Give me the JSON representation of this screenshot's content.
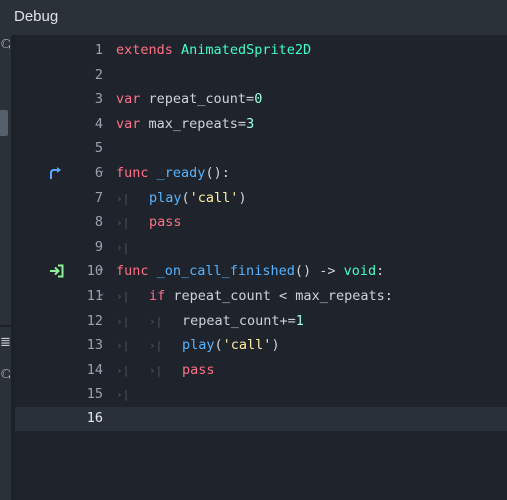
{
  "window": {
    "title": "Debug"
  },
  "colors": {
    "keyword": "#ff7085",
    "class_name": "#42ffc2",
    "function": "#57b3ff",
    "string": "#ffeda1",
    "number": "#a1ffe0",
    "text": "#cdd3db",
    "background": "#1f242c"
  },
  "lines": [
    {
      "n": "1",
      "t1": "extends",
      "t2": " ",
      "t3": "AnimatedSprite2D"
    },
    {
      "n": "2"
    },
    {
      "n": "3",
      "t1": "var",
      "t2": " repeat_count=",
      "t3": "0"
    },
    {
      "n": "4",
      "t1": "var",
      "t2": " max_repeats=",
      "t3": "3"
    },
    {
      "n": "5"
    },
    {
      "n": "6",
      "t1": "func",
      "t2": " ",
      "t3": "_ready",
      "t4": "():"
    },
    {
      "n": "7",
      "t1": "play",
      "t2": "(",
      "t3": "'call'",
      "t4": ")"
    },
    {
      "n": "8",
      "t1": "pass"
    },
    {
      "n": "9"
    },
    {
      "n": "10",
      "t1": "func",
      "t2": " ",
      "t3": "_on_call_finished",
      "t4": "() -> ",
      "t5": "void",
      "t6": ":"
    },
    {
      "n": "11",
      "t1": "if",
      "t2": " repeat_count < max_repeats:"
    },
    {
      "n": "12",
      "t1": "repeat_count+=",
      "t2": "1"
    },
    {
      "n": "13",
      "t1": "play",
      "t2": "(",
      "t3": "'call'",
      "t4": ")"
    },
    {
      "n": "14",
      "t1": "pass"
    },
    {
      "n": "15"
    },
    {
      "n": "16"
    }
  ],
  "icons": {
    "fold": "chevron-down-icon",
    "indent_guide": "tab-indent-icon",
    "connection": "signal-connection-icon",
    "method_link": "method-link-icon"
  }
}
